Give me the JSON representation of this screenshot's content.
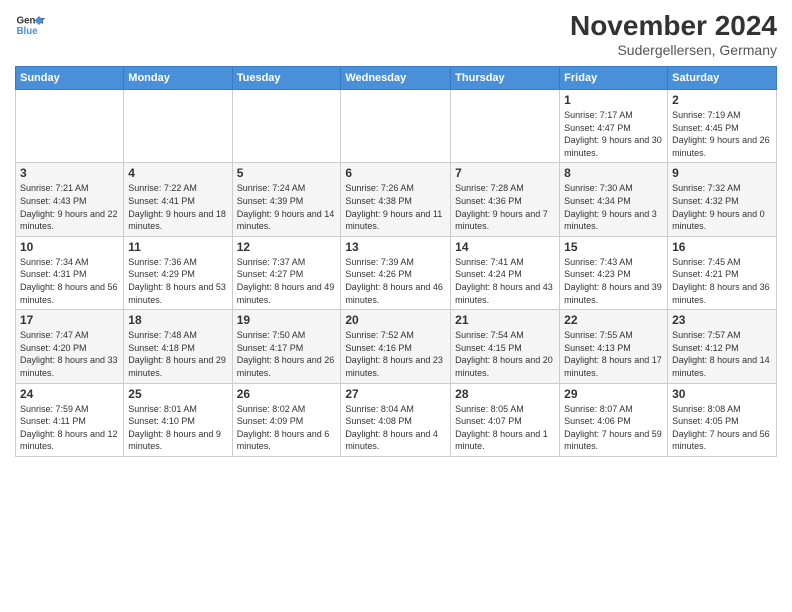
{
  "logo": {
    "line1": "General",
    "line2": "Blue"
  },
  "title": "November 2024",
  "subtitle": "Sudergellersen, Germany",
  "days_of_week": [
    "Sunday",
    "Monday",
    "Tuesday",
    "Wednesday",
    "Thursday",
    "Friday",
    "Saturday"
  ],
  "weeks": [
    [
      {
        "day": "",
        "info": ""
      },
      {
        "day": "",
        "info": ""
      },
      {
        "day": "",
        "info": ""
      },
      {
        "day": "",
        "info": ""
      },
      {
        "day": "",
        "info": ""
      },
      {
        "day": "1",
        "info": "Sunrise: 7:17 AM\nSunset: 4:47 PM\nDaylight: 9 hours and 30 minutes."
      },
      {
        "day": "2",
        "info": "Sunrise: 7:19 AM\nSunset: 4:45 PM\nDaylight: 9 hours and 26 minutes."
      }
    ],
    [
      {
        "day": "3",
        "info": "Sunrise: 7:21 AM\nSunset: 4:43 PM\nDaylight: 9 hours and 22 minutes."
      },
      {
        "day": "4",
        "info": "Sunrise: 7:22 AM\nSunset: 4:41 PM\nDaylight: 9 hours and 18 minutes."
      },
      {
        "day": "5",
        "info": "Sunrise: 7:24 AM\nSunset: 4:39 PM\nDaylight: 9 hours and 14 minutes."
      },
      {
        "day": "6",
        "info": "Sunrise: 7:26 AM\nSunset: 4:38 PM\nDaylight: 9 hours and 11 minutes."
      },
      {
        "day": "7",
        "info": "Sunrise: 7:28 AM\nSunset: 4:36 PM\nDaylight: 9 hours and 7 minutes."
      },
      {
        "day": "8",
        "info": "Sunrise: 7:30 AM\nSunset: 4:34 PM\nDaylight: 9 hours and 3 minutes."
      },
      {
        "day": "9",
        "info": "Sunrise: 7:32 AM\nSunset: 4:32 PM\nDaylight: 9 hours and 0 minutes."
      }
    ],
    [
      {
        "day": "10",
        "info": "Sunrise: 7:34 AM\nSunset: 4:31 PM\nDaylight: 8 hours and 56 minutes."
      },
      {
        "day": "11",
        "info": "Sunrise: 7:36 AM\nSunset: 4:29 PM\nDaylight: 8 hours and 53 minutes."
      },
      {
        "day": "12",
        "info": "Sunrise: 7:37 AM\nSunset: 4:27 PM\nDaylight: 8 hours and 49 minutes."
      },
      {
        "day": "13",
        "info": "Sunrise: 7:39 AM\nSunset: 4:26 PM\nDaylight: 8 hours and 46 minutes."
      },
      {
        "day": "14",
        "info": "Sunrise: 7:41 AM\nSunset: 4:24 PM\nDaylight: 8 hours and 43 minutes."
      },
      {
        "day": "15",
        "info": "Sunrise: 7:43 AM\nSunset: 4:23 PM\nDaylight: 8 hours and 39 minutes."
      },
      {
        "day": "16",
        "info": "Sunrise: 7:45 AM\nSunset: 4:21 PM\nDaylight: 8 hours and 36 minutes."
      }
    ],
    [
      {
        "day": "17",
        "info": "Sunrise: 7:47 AM\nSunset: 4:20 PM\nDaylight: 8 hours and 33 minutes."
      },
      {
        "day": "18",
        "info": "Sunrise: 7:48 AM\nSunset: 4:18 PM\nDaylight: 8 hours and 29 minutes."
      },
      {
        "day": "19",
        "info": "Sunrise: 7:50 AM\nSunset: 4:17 PM\nDaylight: 8 hours and 26 minutes."
      },
      {
        "day": "20",
        "info": "Sunrise: 7:52 AM\nSunset: 4:16 PM\nDaylight: 8 hours and 23 minutes."
      },
      {
        "day": "21",
        "info": "Sunrise: 7:54 AM\nSunset: 4:15 PM\nDaylight: 8 hours and 20 minutes."
      },
      {
        "day": "22",
        "info": "Sunrise: 7:55 AM\nSunset: 4:13 PM\nDaylight: 8 hours and 17 minutes."
      },
      {
        "day": "23",
        "info": "Sunrise: 7:57 AM\nSunset: 4:12 PM\nDaylight: 8 hours and 14 minutes."
      }
    ],
    [
      {
        "day": "24",
        "info": "Sunrise: 7:59 AM\nSunset: 4:11 PM\nDaylight: 8 hours and 12 minutes."
      },
      {
        "day": "25",
        "info": "Sunrise: 8:01 AM\nSunset: 4:10 PM\nDaylight: 8 hours and 9 minutes."
      },
      {
        "day": "26",
        "info": "Sunrise: 8:02 AM\nSunset: 4:09 PM\nDaylight: 8 hours and 6 minutes."
      },
      {
        "day": "27",
        "info": "Sunrise: 8:04 AM\nSunset: 4:08 PM\nDaylight: 8 hours and 4 minutes."
      },
      {
        "day": "28",
        "info": "Sunrise: 8:05 AM\nSunset: 4:07 PM\nDaylight: 8 hours and 1 minute."
      },
      {
        "day": "29",
        "info": "Sunrise: 8:07 AM\nSunset: 4:06 PM\nDaylight: 7 hours and 59 minutes."
      },
      {
        "day": "30",
        "info": "Sunrise: 8:08 AM\nSunset: 4:05 PM\nDaylight: 7 hours and 56 minutes."
      }
    ]
  ]
}
